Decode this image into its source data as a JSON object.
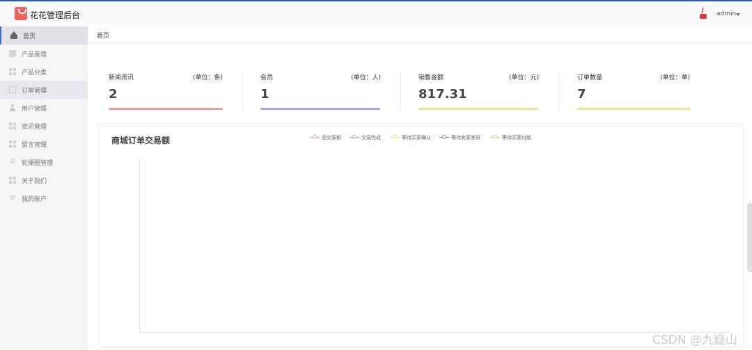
{
  "app": {
    "title": "花花管理后台"
  },
  "header": {
    "username": "admin"
  },
  "sidebar": {
    "items": [
      {
        "label": "首页",
        "icon": "home-icon"
      },
      {
        "label": "产品管理",
        "icon": "product-icon"
      },
      {
        "label": "产品分类",
        "icon": "grid-icon"
      },
      {
        "label": "订单管理",
        "icon": "document-icon"
      },
      {
        "label": "用户管理",
        "icon": "user-icon"
      },
      {
        "label": "资讯管理",
        "icon": "grid-icon"
      },
      {
        "label": "留言管理",
        "icon": "grid-icon"
      },
      {
        "label": "轮播图管理",
        "icon": "gear-icon"
      },
      {
        "label": "关于我们",
        "icon": "grid-icon"
      },
      {
        "label": "我的账户",
        "icon": "gear-icon"
      }
    ]
  },
  "breadcrumb": "首页",
  "stats": [
    {
      "title": "新闻资讯",
      "unit": "(单位：条)",
      "value": "2",
      "color": "#f39a9b"
    },
    {
      "title": "会员",
      "unit": "(单位：人)",
      "value": "1",
      "color": "#9ea5ee"
    },
    {
      "title": "销售金额",
      "unit": "(单位：元)",
      "value": "817.31",
      "color": "#f6e08b"
    },
    {
      "title": "订单数量",
      "unit": "(单位：单)",
      "value": "7",
      "color": "#f6e08b"
    }
  ],
  "chart": {
    "title": "商城订单交易额",
    "legend": [
      {
        "name": "总交易额",
        "color": "#f0a3ad"
      },
      {
        "name": "交易完成",
        "color": "#a6abe8"
      },
      {
        "name": "等待买家确认",
        "color": "#f3e29a"
      },
      {
        "name": "等待卖家发货",
        "color": "#8d8d8d"
      },
      {
        "name": "等待买家付款",
        "color": "#f3c999"
      }
    ]
  },
  "chart_data": {
    "type": "line",
    "title": "商城订单交易额",
    "xlabel": "",
    "ylabel": "",
    "series": [
      {
        "name": "总交易额",
        "values": []
      },
      {
        "name": "交易完成",
        "values": []
      },
      {
        "name": "等待买家确认",
        "values": []
      },
      {
        "name": "等待卖家发货",
        "values": []
      },
      {
        "name": "等待买家付款",
        "values": []
      }
    ],
    "legend": "top-center",
    "grid": false
  },
  "watermark": "CSDN @九嶷山"
}
